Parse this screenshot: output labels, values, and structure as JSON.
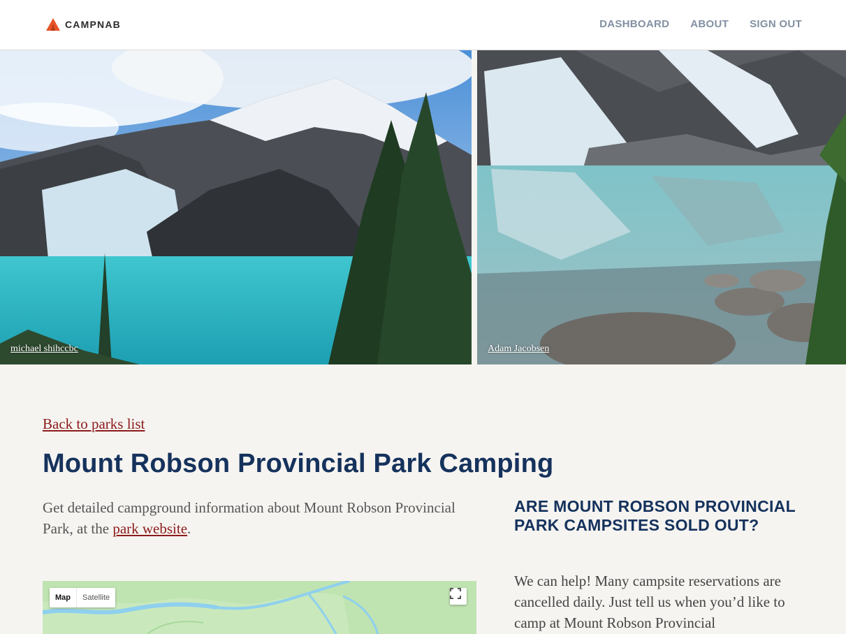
{
  "header": {
    "brand": "CAMPNAB",
    "nav": [
      "DASHBOARD",
      "ABOUT",
      "SIGN OUT"
    ]
  },
  "hero": {
    "credit_left": "michael shihccbc",
    "credit_right": "Adam Jacobsen"
  },
  "content": {
    "back_link": "Back to parks list",
    "title": "Mount Robson Provincial Park Camping",
    "intro_text": "Get detailed campground information about Mount Robson Provincial Park, at the ",
    "intro_link": "park website",
    "intro_end": ".",
    "side_title": "ARE MOUNT ROBSON PROVINCIAL PARK CAMPSITES SOLD OUT?",
    "side_text": "We can help! Many campsite reservations are cancelled daily. Just tell us when you’d like to camp at Mount Robson Provincial"
  },
  "map": {
    "map_label": "Map",
    "satellite_label": "Satellite"
  },
  "colors": {
    "accent_red": "#8b1a1a",
    "title_navy": "#15325c",
    "logo_orange": "#e8542a",
    "nav_gray": "#8390a2"
  },
  "icons": [
    "campnab-logo-icon",
    "fullscreen-icon"
  ]
}
